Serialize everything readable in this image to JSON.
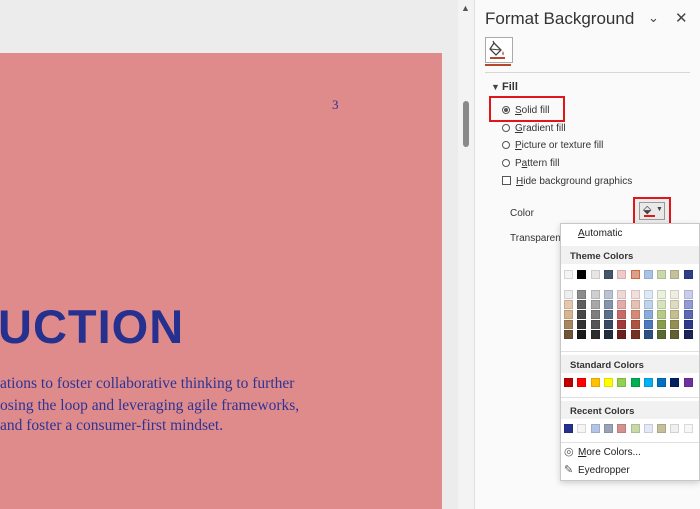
{
  "slide": {
    "page_number": "3",
    "title": "UCTION",
    "body_lines": [
      "ations to foster collaborative thinking to further",
      "osing the loop and leveraging agile frameworks,",
      " and foster a consumer-first mindset."
    ]
  },
  "pane": {
    "title": "Format Background",
    "collapse_icon": "chevron-down",
    "close_icon": "x",
    "fill_heading": "Fill",
    "options": {
      "solid_fill": "Solid fill",
      "gradient_fill": "Gradient fill",
      "picture_fill": "Picture or texture fill",
      "pattern_fill": "Pattern fill",
      "hide_graphics": "Hide background graphics"
    },
    "selected_option": "solid_fill",
    "color_label": "Color",
    "transparency_label": "Transparenc"
  },
  "color_menu": {
    "automatic": "Automatic",
    "theme_colors_label": "Theme Colors",
    "theme_top_row": [
      "#f4f4f4",
      "#000000",
      "#e6e6e6",
      "#45556b",
      "#f3c8c8",
      "#d9a08e",
      "#a9c3e8",
      "#c6d9a7",
      "#c4c09a",
      "#2e3f8a"
    ],
    "theme_columns": [
      [
        "#eeeeee",
        "#e3c8b0",
        "#d8b48f",
        "#a88660",
        "#6e5338"
      ],
      [
        "#8c8c8c",
        "#5f5f5f",
        "#474747",
        "#333333",
        "#1a1a1a"
      ],
      [
        "#cfcfcf",
        "#a8a8a8",
        "#7e7e7e",
        "#555555",
        "#2e2e2e"
      ],
      [
        "#b9c3d1",
        "#8795ab",
        "#5b6f8b",
        "#3a4a64",
        "#222d3e"
      ],
      [
        "#f1d8d8",
        "#e4abab",
        "#cc6a6a",
        "#a23a3a",
        "#6b1f1f"
      ],
      [
        "#f3dedb",
        "#e7c0b4",
        "#d68a76",
        "#b05440",
        "#763322"
      ],
      [
        "#dfe9f6",
        "#bed3ee",
        "#89acdd",
        "#4e79bf",
        "#2d4f86"
      ],
      [
        "#eaf1dd",
        "#d6e3bc",
        "#b5cc86",
        "#879f4d",
        "#586a2f"
      ],
      [
        "#eeeddf",
        "#dedbc0",
        "#c4bf8c",
        "#968f52",
        "#635f33"
      ],
      [
        "#c7cdea",
        "#929bd3",
        "#5c67b7",
        "#2e3a8a",
        "#1b2358"
      ]
    ],
    "standard_colors_label": "Standard Colors",
    "standard_colors": [
      "#c00000",
      "#ff0000",
      "#ffc000",
      "#ffff00",
      "#92d050",
      "#00b050",
      "#00b0f0",
      "#0070c0",
      "#002060",
      "#7030a0"
    ],
    "recent_colors_label": "Recent Colors",
    "recent_colors": [
      "#26308e",
      "#f5f5f5",
      "#b3c4e6",
      "#9aa4b6",
      "#d4918e",
      "#c6d9a7",
      "#e3e9f6",
      "#c4c09a",
      "#f0f0f0",
      "#f7f7f7"
    ],
    "more_colors": "More Colors...",
    "eyedropper": "Eyedropper",
    "highlight_color": "#e0161b"
  }
}
